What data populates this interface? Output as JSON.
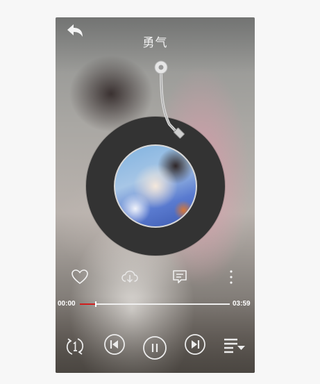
{
  "header": {
    "title": "勇气",
    "back_icon": "back-arrow-icon"
  },
  "player": {
    "elapsed": "00:00",
    "duration": "03:59",
    "progress_fraction": 0.1,
    "played_color": "#d11d1d"
  },
  "actions": [
    "heart-icon",
    "download-icon",
    "comment-icon",
    "more-vertical-icon"
  ],
  "controls": [
    "repeat-one-icon",
    "previous-icon",
    "pause-icon",
    "next-icon",
    "playlist-icon"
  ]
}
